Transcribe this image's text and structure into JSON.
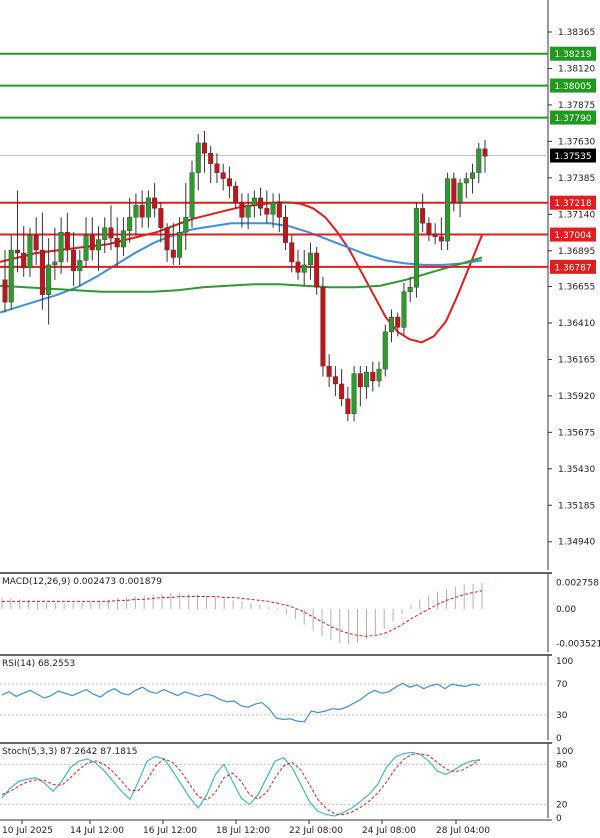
{
  "chart_data": {
    "type": "candlestick",
    "instrument_note": "",
    "price_axis": {
      "range": [
        1.3475,
        1.3858
      ],
      "ticks": [
        "1.38365",
        "1.38120",
        "1.37875",
        "1.37630",
        "1.37385",
        "1.37140",
        "1.36895",
        "1.36655",
        "1.36410",
        "1.36165",
        "1.35920",
        "1.35675",
        "1.35430",
        "1.35185",
        "1.34940"
      ]
    },
    "levels": [
      {
        "label": "1.38219",
        "value": 1.38219,
        "color": "#1f9a1f",
        "type": "resistance"
      },
      {
        "label": "1.38005",
        "value": 1.38005,
        "color": "#1f9a1f",
        "type": "resistance"
      },
      {
        "label": "1.37790",
        "value": 1.3779,
        "color": "#1f9a1f",
        "type": "resistance"
      },
      {
        "label": "1.37218",
        "value": 1.37218,
        "color": "#e11d1d",
        "type": "support"
      },
      {
        "label": "1.37004",
        "value": 1.37004,
        "color": "#e11d1d",
        "type": "support"
      },
      {
        "label": "1.36787",
        "value": 1.36787,
        "color": "#e11d1d",
        "type": "support"
      }
    ],
    "current_price": {
      "label": "1.37535",
      "value": 1.37535
    },
    "time_labels": [
      "10 Jul 2025",
      "14 Jul 12:00",
      "16 Jul 12:00",
      "18 Jul 12:00",
      "22 Jul 08:00",
      "24 Jul 08:00",
      "28 Jul 04:00"
    ],
    "candles": [
      {
        "o": 1.367,
        "h": 1.369,
        "l": 1.3648,
        "c": 1.3655
      },
      {
        "o": 1.3655,
        "h": 1.37,
        "l": 1.365,
        "c": 1.369
      },
      {
        "o": 1.369,
        "h": 1.373,
        "l": 1.3675,
        "c": 1.3688
      },
      {
        "o": 1.3688,
        "h": 1.3706,
        "l": 1.3672,
        "c": 1.3678
      },
      {
        "o": 1.3678,
        "h": 1.3705,
        "l": 1.3672,
        "c": 1.37
      },
      {
        "o": 1.37,
        "h": 1.3712,
        "l": 1.368,
        "c": 1.369
      },
      {
        "o": 1.369,
        "h": 1.3715,
        "l": 1.365,
        "c": 1.366
      },
      {
        "o": 1.366,
        "h": 1.3698,
        "l": 1.364,
        "c": 1.368
      },
      {
        "o": 1.368,
        "h": 1.3705,
        "l": 1.367,
        "c": 1.3682
      },
      {
        "o": 1.3682,
        "h": 1.3712,
        "l": 1.3674,
        "c": 1.3702
      },
      {
        "o": 1.3702,
        "h": 1.3715,
        "l": 1.3682,
        "c": 1.369
      },
      {
        "o": 1.369,
        "h": 1.3702,
        "l": 1.3666,
        "c": 1.3676
      },
      {
        "o": 1.3676,
        "h": 1.369,
        "l": 1.3666,
        "c": 1.3683
      },
      {
        "o": 1.3683,
        "h": 1.3712,
        "l": 1.3678,
        "c": 1.37
      },
      {
        "o": 1.37,
        "h": 1.3712,
        "l": 1.3683,
        "c": 1.369
      },
      {
        "o": 1.369,
        "h": 1.3706,
        "l": 1.3676,
        "c": 1.3697
      },
      {
        "o": 1.3697,
        "h": 1.3712,
        "l": 1.3688,
        "c": 1.3705
      },
      {
        "o": 1.3705,
        "h": 1.372,
        "l": 1.369,
        "c": 1.3698
      },
      {
        "o": 1.3698,
        "h": 1.3712,
        "l": 1.3679,
        "c": 1.3692
      },
      {
        "o": 1.3692,
        "h": 1.3712,
        "l": 1.3686,
        "c": 1.3703
      },
      {
        "o": 1.3703,
        "h": 1.3725,
        "l": 1.3695,
        "c": 1.3712
      },
      {
        "o": 1.3712,
        "h": 1.3728,
        "l": 1.37,
        "c": 1.372
      },
      {
        "o": 1.372,
        "h": 1.373,
        "l": 1.3705,
        "c": 1.3712
      },
      {
        "o": 1.3712,
        "h": 1.373,
        "l": 1.3705,
        "c": 1.3725
      },
      {
        "o": 1.3725,
        "h": 1.3735,
        "l": 1.3712,
        "c": 1.3718
      },
      {
        "o": 1.3718,
        "h": 1.3722,
        "l": 1.3695,
        "c": 1.3705
      },
      {
        "o": 1.3705,
        "h": 1.3708,
        "l": 1.3682,
        "c": 1.369
      },
      {
        "o": 1.369,
        "h": 1.3708,
        "l": 1.368,
        "c": 1.3685
      },
      {
        "o": 1.3685,
        "h": 1.3712,
        "l": 1.368,
        "c": 1.3702
      },
      {
        "o": 1.3702,
        "h": 1.3735,
        "l": 1.369,
        "c": 1.3712
      },
      {
        "o": 1.3712,
        "h": 1.375,
        "l": 1.3705,
        "c": 1.3742
      },
      {
        "o": 1.3742,
        "h": 1.3768,
        "l": 1.373,
        "c": 1.3762
      },
      {
        "o": 1.3762,
        "h": 1.377,
        "l": 1.3742,
        "c": 1.3755
      },
      {
        "o": 1.3755,
        "h": 1.376,
        "l": 1.3735,
        "c": 1.3748
      },
      {
        "o": 1.3748,
        "h": 1.3755,
        "l": 1.3735,
        "c": 1.3742
      },
      {
        "o": 1.3742,
        "h": 1.3748,
        "l": 1.373,
        "c": 1.3738
      },
      {
        "o": 1.3738,
        "h": 1.3746,
        "l": 1.3725,
        "c": 1.3733
      },
      {
        "o": 1.3733,
        "h": 1.3736,
        "l": 1.3718,
        "c": 1.3722
      },
      {
        "o": 1.3722,
        "h": 1.3728,
        "l": 1.3705,
        "c": 1.3712
      },
      {
        "o": 1.3712,
        "h": 1.3728,
        "l": 1.3704,
        "c": 1.372
      },
      {
        "o": 1.372,
        "h": 1.373,
        "l": 1.3712,
        "c": 1.3725
      },
      {
        "o": 1.3725,
        "h": 1.3732,
        "l": 1.3713,
        "c": 1.3718
      },
      {
        "o": 1.3718,
        "h": 1.373,
        "l": 1.3708,
        "c": 1.3714
      },
      {
        "o": 1.3714,
        "h": 1.3728,
        "l": 1.3705,
        "c": 1.3722
      },
      {
        "o": 1.3722,
        "h": 1.3728,
        "l": 1.3702,
        "c": 1.3712
      },
      {
        "o": 1.3712,
        "h": 1.372,
        "l": 1.369,
        "c": 1.3695
      },
      {
        "o": 1.3695,
        "h": 1.37,
        "l": 1.3675,
        "c": 1.3682
      },
      {
        "o": 1.3682,
        "h": 1.369,
        "l": 1.367,
        "c": 1.3675
      },
      {
        "o": 1.3675,
        "h": 1.369,
        "l": 1.3666,
        "c": 1.368
      },
      {
        "o": 1.368,
        "h": 1.3695,
        "l": 1.367,
        "c": 1.3688
      },
      {
        "o": 1.3688,
        "h": 1.3692,
        "l": 1.366,
        "c": 1.3665
      },
      {
        "o": 1.3665,
        "h": 1.3672,
        "l": 1.3605,
        "c": 1.3612
      },
      {
        "o": 1.3612,
        "h": 1.362,
        "l": 1.3598,
        "c": 1.3605
      },
      {
        "o": 1.3605,
        "h": 1.3612,
        "l": 1.3592,
        "c": 1.36
      },
      {
        "o": 1.36,
        "h": 1.361,
        "l": 1.3585,
        "c": 1.359
      },
      {
        "o": 1.359,
        "h": 1.3598,
        "l": 1.3575,
        "c": 1.358
      },
      {
        "o": 1.358,
        "h": 1.3612,
        "l": 1.3575,
        "c": 1.3607
      },
      {
        "o": 1.3607,
        "h": 1.3612,
        "l": 1.3585,
        "c": 1.3598
      },
      {
        "o": 1.3598,
        "h": 1.3612,
        "l": 1.359,
        "c": 1.3608
      },
      {
        "o": 1.3608,
        "h": 1.3615,
        "l": 1.3595,
        "c": 1.3602
      },
      {
        "o": 1.3602,
        "h": 1.3615,
        "l": 1.3598,
        "c": 1.361
      },
      {
        "o": 1.361,
        "h": 1.364,
        "l": 1.3605,
        "c": 1.3635
      },
      {
        "o": 1.3635,
        "h": 1.365,
        "l": 1.3628,
        "c": 1.3645
      },
      {
        "o": 1.3645,
        "h": 1.3648,
        "l": 1.3632,
        "c": 1.3638
      },
      {
        "o": 1.3638,
        "h": 1.3668,
        "l": 1.3633,
        "c": 1.3662
      },
      {
        "o": 1.3662,
        "h": 1.3672,
        "l": 1.3655,
        "c": 1.3665
      },
      {
        "o": 1.3665,
        "h": 1.3722,
        "l": 1.3658,
        "c": 1.3718
      },
      {
        "o": 1.3718,
        "h": 1.3728,
        "l": 1.3702,
        "c": 1.3708
      },
      {
        "o": 1.3708,
        "h": 1.3712,
        "l": 1.3696,
        "c": 1.3701
      },
      {
        "o": 1.3701,
        "h": 1.3708,
        "l": 1.3694,
        "c": 1.3699
      },
      {
        "o": 1.3699,
        "h": 1.3712,
        "l": 1.369,
        "c": 1.3696
      },
      {
        "o": 1.3696,
        "h": 1.3742,
        "l": 1.369,
        "c": 1.3738
      },
      {
        "o": 1.3738,
        "h": 1.3742,
        "l": 1.3716,
        "c": 1.3722
      },
      {
        "o": 1.3722,
        "h": 1.3738,
        "l": 1.3712,
        "c": 1.3735
      },
      {
        "o": 1.3735,
        "h": 1.3742,
        "l": 1.3725,
        "c": 1.3738
      },
      {
        "o": 1.3738,
        "h": 1.3748,
        "l": 1.3728,
        "c": 1.3742
      },
      {
        "o": 1.3742,
        "h": 1.3762,
        "l": 1.3735,
        "c": 1.3758
      },
      {
        "o": 1.3758,
        "h": 1.3764,
        "l": 1.3742,
        "c": 1.3753
      }
    ],
    "moving_averages": [
      {
        "color": "#e11d1d",
        "values": [
          1.3682,
          1.3684,
          1.3686,
          1.3688,
          1.3689,
          1.369,
          1.3691,
          1.3692,
          1.3693,
          1.3694,
          1.3696,
          1.3698,
          1.37,
          1.3702,
          1.3705,
          1.3708,
          1.3711,
          1.3713,
          1.3715,
          1.3717,
          1.3719,
          1.372,
          1.3721,
          1.3722,
          1.3722,
          1.3721,
          1.3718,
          1.3712,
          1.3702,
          1.369,
          1.3675,
          1.366,
          1.3645,
          1.3635,
          1.363,
          1.3628,
          1.3632,
          1.3642,
          1.366,
          1.368,
          1.37
        ]
      },
      {
        "color": "#3a8fe0",
        "values": [
          1.3648,
          1.3652,
          1.3656,
          1.366,
          1.3665,
          1.3672,
          1.368,
          1.3688,
          1.3695,
          1.37,
          1.3704,
          1.3706,
          1.3708,
          1.3708,
          1.3708,
          1.3706,
          1.3702,
          1.3697,
          1.3692,
          1.3687,
          1.3683,
          1.3681,
          1.368,
          1.368,
          1.3681,
          1.3683
        ]
      },
      {
        "color": "#2e9a2e",
        "values": [
          1.3666,
          1.3665,
          1.3664,
          1.3663,
          1.3662,
          1.3662,
          1.3662,
          1.3663,
          1.3665,
          1.3666,
          1.3667,
          1.3667,
          1.3666,
          1.3665,
          1.3665,
          1.3666,
          1.367,
          1.3675,
          1.368,
          1.3685
        ]
      }
    ],
    "macd": {
      "label": "MACD(12,26,9) 0.002473 0.001879",
      "axis_ticks": [
        "0.002758",
        "0.00",
        "-0.003521"
      ],
      "range": [
        -0.004,
        0.0031
      ],
      "histogram": [
        0.0012,
        0.0011,
        0.001,
        0.0009,
        0.0008,
        0.0007,
        0.0006,
        0.0005,
        0.0006,
        0.0007,
        0.0008,
        0.0009,
        0.001,
        0.0011,
        0.0012,
        0.0013,
        0.0014,
        0.0015,
        0.0016,
        0.0017,
        0.0017,
        0.0016,
        0.0015,
        0.0014,
        0.0013,
        0.0011,
        0.0009,
        0.0008,
        0.0006,
        0.0004,
        0.0002,
        -0.0001,
        -0.0005,
        -0.001,
        -0.0016,
        -0.0022,
        -0.0028,
        -0.0032,
        -0.0035,
        -0.0036,
        -0.0035,
        -0.0031,
        -0.0026,
        -0.002,
        -0.0013,
        -0.0005,
        0.0004,
        0.001,
        0.0014,
        0.0018,
        0.0021,
        0.0023,
        0.0025,
        0.0026,
        0.0027
      ],
      "signal": [
        0.0008,
        0.0008,
        0.0008,
        0.0008,
        0.0008,
        0.0008,
        0.0008,
        0.0008,
        0.0008,
        0.0008,
        0.0008,
        0.0008,
        0.0008,
        0.0009,
        0.0009,
        0.001,
        0.001,
        0.0011,
        0.0012,
        0.0012,
        0.0013,
        0.0013,
        0.0013,
        0.0013,
        0.0013,
        0.0012,
        0.0012,
        0.0011,
        0.001,
        0.0009,
        0.0008,
        0.0006,
        0.0004,
        0.0001,
        -0.0003,
        -0.0008,
        -0.0013,
        -0.0018,
        -0.0022,
        -0.0025,
        -0.0027,
        -0.0028,
        -0.0027,
        -0.0025,
        -0.0021,
        -0.0016,
        -0.001,
        -0.0005,
        0.0,
        0.0005,
        0.0009,
        0.0012,
        0.0015,
        0.0017,
        0.0019
      ]
    },
    "rsi": {
      "label": "RSI(14) 68.2553",
      "axis_ticks": [
        "100",
        "70",
        "30",
        "0"
      ],
      "values": [
        56,
        60,
        54,
        58,
        62,
        57,
        52,
        55,
        61,
        58,
        55,
        59,
        63,
        57,
        53,
        60,
        64,
        58,
        56,
        62,
        66,
        60,
        58,
        63,
        59,
        55,
        60,
        57,
        54,
        57,
        55,
        50,
        47,
        48,
        42,
        40,
        44,
        46,
        38,
        26,
        24,
        25,
        22,
        21,
        35,
        33,
        35,
        38,
        37,
        40,
        45,
        50,
        57,
        62,
        58,
        60,
        66,
        71,
        66,
        69,
        64,
        68,
        70,
        64,
        70,
        68,
        67,
        70,
        68
      ]
    },
    "stoch": {
      "label": "Stoch(5,3,3) 87.2642 87.1815",
      "axis_ticks": [
        "100",
        "80",
        "20",
        "0"
      ],
      "k": [
        30,
        45,
        55,
        58,
        60,
        52,
        40,
        55,
        75,
        85,
        88,
        82,
        70,
        55,
        40,
        28,
        55,
        85,
        92,
        88,
        70,
        50,
        30,
        15,
        35,
        65,
        80,
        55,
        30,
        20,
        35,
        60,
        85,
        90,
        75,
        50,
        25,
        10,
        5,
        3,
        8,
        15,
        25,
        35,
        50,
        75,
        90,
        96,
        98,
        95,
        85,
        70,
        65,
        72,
        80,
        85,
        87
      ],
      "d": [
        35,
        40,
        48,
        54,
        57,
        56,
        50,
        49,
        60,
        72,
        82,
        85,
        80,
        69,
        55,
        41,
        41,
        56,
        78,
        88,
        83,
        69,
        50,
        32,
        27,
        38,
        60,
        67,
        55,
        35,
        28,
        38,
        60,
        78,
        83,
        72,
        50,
        28,
        14,
        6,
        5,
        9,
        16,
        25,
        37,
        53,
        72,
        87,
        95,
        96,
        93,
        83,
        73,
        69,
        72,
        79,
        87
      ]
    }
  }
}
